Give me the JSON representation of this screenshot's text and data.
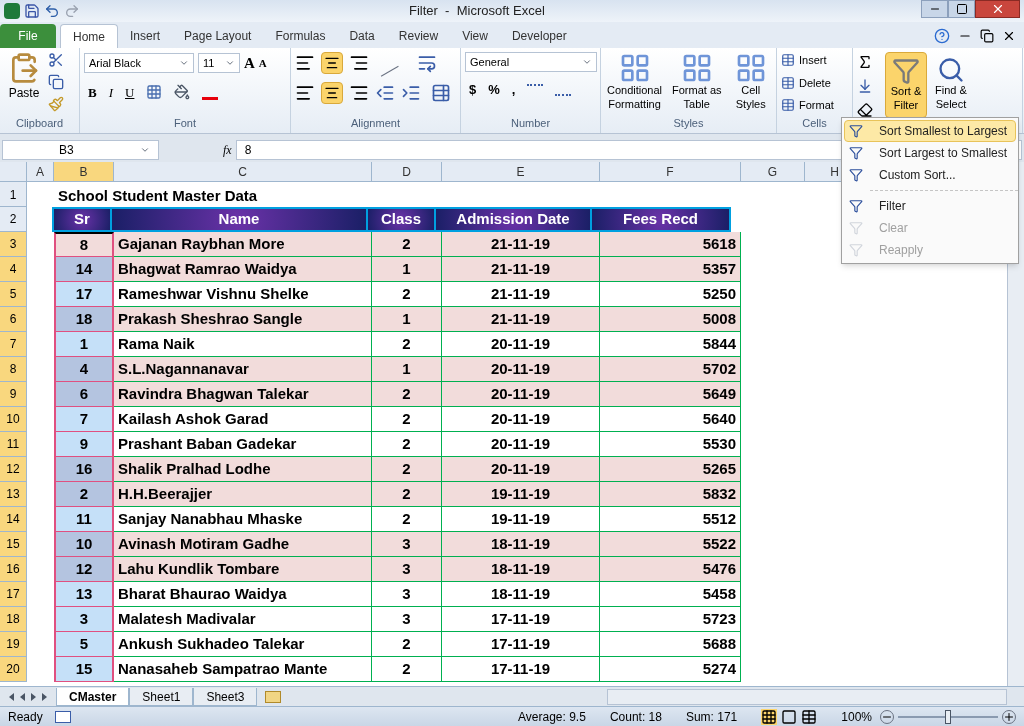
{
  "window": {
    "title": "Filter  -  Microsoft Excel"
  },
  "tabs": [
    {
      "label": "File",
      "kind": "file",
      "selected": false
    },
    {
      "label": "Home",
      "kind": "tab",
      "selected": true
    },
    {
      "label": "Insert",
      "kind": "tab",
      "selected": false
    },
    {
      "label": "Page Layout",
      "kind": "tab",
      "selected": false
    },
    {
      "label": "Formulas",
      "kind": "tab",
      "selected": false
    },
    {
      "label": "Data",
      "kind": "tab",
      "selected": false
    },
    {
      "label": "Review",
      "kind": "tab",
      "selected": false
    },
    {
      "label": "View",
      "kind": "tab",
      "selected": false
    },
    {
      "label": "Developer",
      "kind": "tab",
      "selected": false
    }
  ],
  "ribbon": {
    "clipboard": {
      "paste": "Paste",
      "label": "Clipboard"
    },
    "font": {
      "name": "Arial Black",
      "size": "11",
      "grow": "A",
      "shrink": "A",
      "bold": "B",
      "italic": "I",
      "underline": "U",
      "label": "Font"
    },
    "alignment": {
      "label": "Alignment"
    },
    "number": {
      "format": "General",
      "currency": "$",
      "percent": "%",
      "comma": ",",
      "label": "Number"
    },
    "styles": {
      "buttons": [
        "Conditional Formatting",
        "Format as Table",
        "Cell Styles"
      ],
      "label": "Styles"
    },
    "cells": {
      "buttons": [
        "Insert",
        "Delete",
        "Format"
      ],
      "label": "Cells"
    },
    "editing": {
      "sort_filter": {
        "label": "Sort & Filter",
        "pressed": true
      },
      "find_select": "Find & Select"
    }
  },
  "sort_menu": [
    {
      "label": "Sort Smallest to Largest",
      "kind": "item",
      "selected": true,
      "disabled": false
    },
    {
      "label": "Sort Largest to Smallest",
      "kind": "item",
      "selected": false,
      "disabled": false
    },
    {
      "label": "Custom Sort...",
      "kind": "item",
      "selected": false,
      "disabled": false
    },
    {
      "kind": "separator"
    },
    {
      "label": "Filter",
      "kind": "item",
      "selected": false,
      "disabled": false
    },
    {
      "label": "Clear",
      "kind": "item",
      "selected": false,
      "disabled": true
    },
    {
      "label": "Reapply",
      "kind": "item",
      "selected": false,
      "disabled": true
    }
  ],
  "formula_bar": {
    "name_box": "B3",
    "fx": "fx",
    "value": "8"
  },
  "sheet": {
    "columns": [
      "A",
      "B",
      "C",
      "D",
      "E",
      "F",
      "G",
      "H"
    ],
    "title_row": "1",
    "header_row": "2",
    "title": "School Student Master Data",
    "headers": [
      "Sr",
      "Name",
      "Class",
      "Admission Date",
      "Fees Recd"
    ],
    "rows": [
      {
        "n": "3",
        "sr": "8",
        "name": "Gajanan Raybhan More",
        "class": "2",
        "date": "21-11-19",
        "fees": "5618",
        "shaded": true,
        "active": true
      },
      {
        "n": "4",
        "sr": "14",
        "name": "Bhagwat Ramrao Waidya",
        "class": "1",
        "date": "21-11-19",
        "fees": "5357",
        "shaded": true,
        "active": false
      },
      {
        "n": "5",
        "sr": "17",
        "name": "Rameshwar Vishnu Shelke",
        "class": "2",
        "date": "21-11-19",
        "fees": "5250",
        "shaded": false,
        "active": false
      },
      {
        "n": "6",
        "sr": "18",
        "name": "Prakash Sheshrao Sangle",
        "class": "1",
        "date": "21-11-19",
        "fees": "5008",
        "shaded": true,
        "active": false
      },
      {
        "n": "7",
        "sr": "1",
        "name": "Rama Naik",
        "class": "2",
        "date": "20-11-19",
        "fees": "5844",
        "shaded": false,
        "active": false
      },
      {
        "n": "8",
        "sr": "4",
        "name": "S.L.Nagannanavar",
        "class": "1",
        "date": "20-11-19",
        "fees": "5702",
        "shaded": true,
        "active": false
      },
      {
        "n": "9",
        "sr": "6",
        "name": "Ravindra Bhagwan Talekar",
        "class": "2",
        "date": "20-11-19",
        "fees": "5649",
        "shaded": true,
        "active": false
      },
      {
        "n": "10",
        "sr": "7",
        "name": "Kailash Ashok Garad",
        "class": "2",
        "date": "20-11-19",
        "fees": "5640",
        "shaded": false,
        "active": false
      },
      {
        "n": "11",
        "sr": "9",
        "name": "Prashant Baban Gadekar",
        "class": "2",
        "date": "20-11-19",
        "fees": "5530",
        "shaded": false,
        "active": false
      },
      {
        "n": "12",
        "sr": "16",
        "name": "Shalik Pralhad Lodhe",
        "class": "2",
        "date": "20-11-19",
        "fees": "5265",
        "shaded": true,
        "active": false
      },
      {
        "n": "13",
        "sr": "2",
        "name": "H.H.Beerajjer",
        "class": "2",
        "date": "19-11-19",
        "fees": "5832",
        "shaded": true,
        "active": false
      },
      {
        "n": "14",
        "sr": "11",
        "name": "Sanjay Nanabhau Mhaske",
        "class": "2",
        "date": "19-11-19",
        "fees": "5512",
        "shaded": false,
        "active": false
      },
      {
        "n": "15",
        "sr": "10",
        "name": "Avinash Motiram Gadhe",
        "class": "3",
        "date": "18-11-19",
        "fees": "5522",
        "shaded": true,
        "active": false
      },
      {
        "n": "16",
        "sr": "12",
        "name": "Lahu Kundlik Tombare",
        "class": "3",
        "date": "18-11-19",
        "fees": "5476",
        "shaded": true,
        "active": false
      },
      {
        "n": "17",
        "sr": "13",
        "name": "Bharat Bhaurao Waidya",
        "class": "3",
        "date": "18-11-19",
        "fees": "5458",
        "shaded": false,
        "active": false
      },
      {
        "n": "18",
        "sr": "3",
        "name": "Malatesh Madivalar",
        "class": "3",
        "date": "17-11-19",
        "fees": "5723",
        "shaded": false,
        "active": false
      },
      {
        "n": "19",
        "sr": "5",
        "name": "Ankush Sukhadeo Talekar",
        "class": "2",
        "date": "17-11-19",
        "fees": "5688",
        "shaded": false,
        "active": false
      },
      {
        "n": "20",
        "sr": "15",
        "name": "Nanasaheb Sampatrao Mante",
        "class": "2",
        "date": "17-11-19",
        "fees": "5274",
        "shaded": false,
        "active": false
      }
    ]
  },
  "sheet_tabs": [
    {
      "label": "CMaster",
      "selected": true
    },
    {
      "label": "Sheet1",
      "selected": false
    },
    {
      "label": "Sheet3",
      "selected": false
    }
  ],
  "status_bar": {
    "mode": "Ready",
    "average": "Average: 9.5",
    "count": "Count: 18",
    "sum": "Sum: 171",
    "zoom": "100%",
    "zoom_slider": {
      "level": 0.5
    }
  }
}
